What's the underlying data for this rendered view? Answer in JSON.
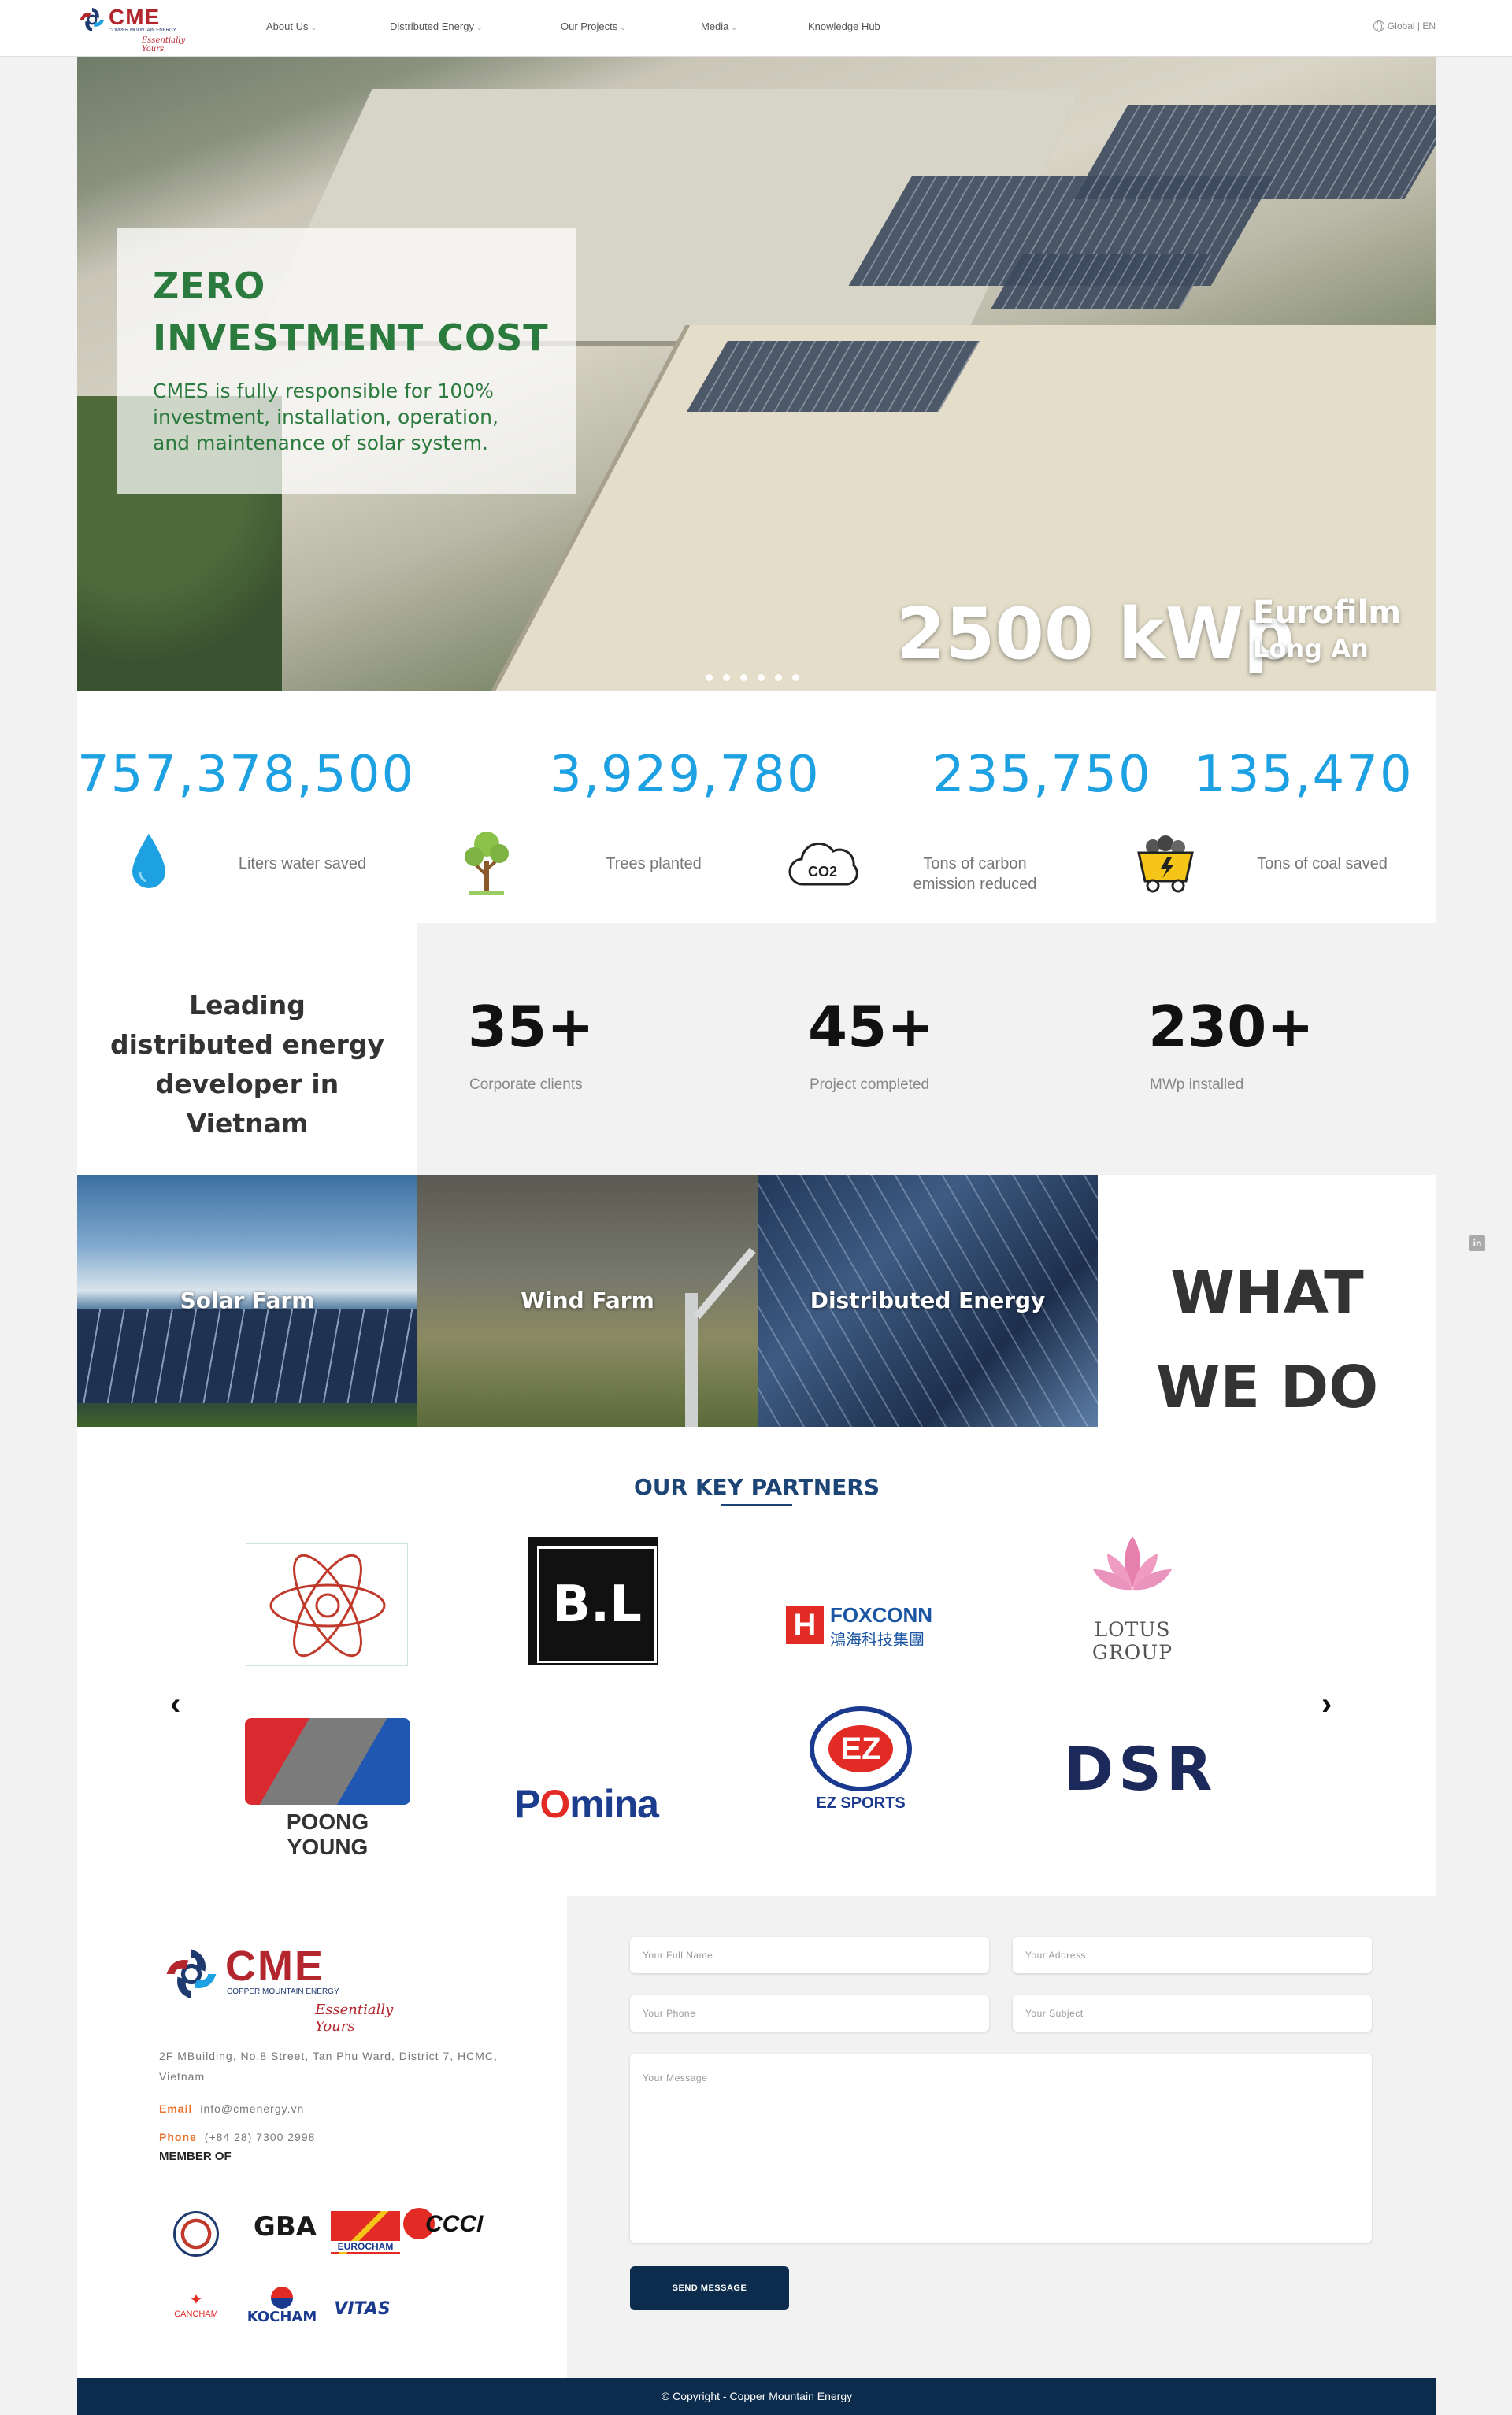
{
  "brand": {
    "name": "CME",
    "subtitle": "COPPER MOUNTAIN ENERGY",
    "tagline": "Essentially Yours"
  },
  "nav": {
    "items": [
      {
        "label": "About Us",
        "has_dropdown": true
      },
      {
        "label": "Distributed Energy",
        "has_dropdown": true
      },
      {
        "label": "Our Projects",
        "has_dropdown": true
      },
      {
        "label": "Media",
        "has_dropdown": true
      },
      {
        "label": "Knowledge Hub",
        "has_dropdown": false
      }
    ],
    "language": "Global | EN"
  },
  "hero": {
    "heading_line1": "ZERO",
    "heading_line2": "INVESTMENT COST",
    "text": "CMES is fully responsible for 100% investment, installation, operation, and maintenance of solar system.",
    "capacity": "2500 kWp",
    "site_line1": "Eurofilm",
    "site_line2": "Long An",
    "slide_count": 6,
    "active_slide": 1
  },
  "stats": [
    {
      "value": "757,378,500",
      "label": "Liters water saved",
      "icon": "water-drop-icon"
    },
    {
      "value": "3,929,780",
      "label": "Trees planted",
      "icon": "tree-icon"
    },
    {
      "value": "235,750",
      "label": "Tons of carbon emission reduced",
      "label_line1": "Tons of carbon",
      "label_line2": "emission reduced",
      "icon": "co2-cloud-icon"
    },
    {
      "value": "135,470",
      "label": "Tons of coal saved",
      "icon": "coal-cart-icon"
    }
  ],
  "leading": {
    "line1": "Leading",
    "line2": "distributed energy",
    "line3": "developer in",
    "line4": "Vietnam"
  },
  "kpis": [
    {
      "value": "35+",
      "caption": "Corporate clients"
    },
    {
      "value": "45+",
      "caption": "Project completed"
    },
    {
      "value": "230+",
      "caption": "MWp installed"
    }
  ],
  "services": [
    {
      "label": "Solar Farm"
    },
    {
      "label": "Wind Farm"
    },
    {
      "label": "Distributed Energy"
    }
  ],
  "what_we_do": {
    "line1": "WHAT",
    "line2": "WE DO"
  },
  "partners": {
    "title": "OUR KEY PARTNERS",
    "logos": [
      {
        "name": "atom-logo"
      },
      {
        "name": "B.L"
      },
      {
        "name": "FOXCONN",
        "text_cn": "鴻海科技集團"
      },
      {
        "name": "LOTUS GROUP"
      },
      {
        "name": "POONG YOUNG"
      },
      {
        "name": "POmina"
      },
      {
        "name": "EZ SPORTS"
      },
      {
        "name": "DSR"
      }
    ]
  },
  "contact": {
    "address": "2F MBuilding, No.8 Street, Tan Phu Ward, District 7, HCMC, Vietnam",
    "email_label": "Email",
    "email": "info@cmenergy.vn",
    "phone_label": "Phone",
    "phone": "(+84 28) 7300 2998",
    "member_of": "MEMBER OF",
    "members": [
      "AMCHAM",
      "GBA",
      "EUROCHAM",
      "CCCI",
      "CANCHAM",
      "KOCHAM",
      "VITAS"
    ]
  },
  "form": {
    "full_name_placeholder": "Your Full Name",
    "address_placeholder": "Your Address",
    "phone_placeholder": "Your Phone",
    "subject_placeholder": "Your Subject",
    "message_placeholder": "Your Message",
    "submit_label": "SEND MESSAGE"
  },
  "footer": {
    "copyright": "© Copyright - Copper Mountain Energy"
  },
  "colors": {
    "accent": "#1da1e2",
    "brand_red": "#b3262d",
    "navy": "#0c2c4d",
    "green": "#2b7a3e",
    "orange": "#e8712c"
  }
}
